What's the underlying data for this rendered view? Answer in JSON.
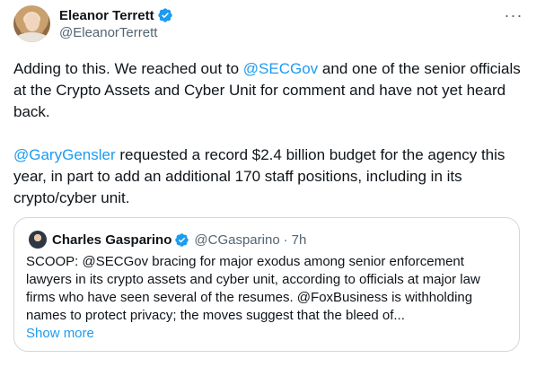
{
  "author": {
    "display_name": "Eleanor Terrett",
    "handle": "@EleanorTerrett",
    "more_icon": "ellipsis-icon"
  },
  "tweet": {
    "para1_prefix": "Adding to this. We reached out to ",
    "para1_mention": "@SECGov",
    "para1_suffix": " and one of the senior officials at the Crypto Assets and Cyber Unit for comment and have not yet heard back.",
    "para2_mention": "@GaryGensler",
    "para2_suffix": " requested a record $2.4 billion budget for the agency this year, in part to add an additional 170 staff positions, including in its crypto/cyber unit."
  },
  "quoted": {
    "display_name": "Charles Gasparino",
    "handle": "@CGasparino",
    "separator": "·",
    "time": "7h",
    "text": "SCOOP: @SECGov bracing for major exodus among senior enforcement lawyers in its crypto assets and cyber unit, according to officials at major law firms who have seen several of the resumes. @FoxBusiness is withholding names to protect privacy; the moves suggest that the bleed of...",
    "show_more": "Show more"
  },
  "colors": {
    "accent": "#1d9bf0",
    "text": "#0f1419",
    "secondary": "#536471",
    "border": "#cfd9de"
  }
}
